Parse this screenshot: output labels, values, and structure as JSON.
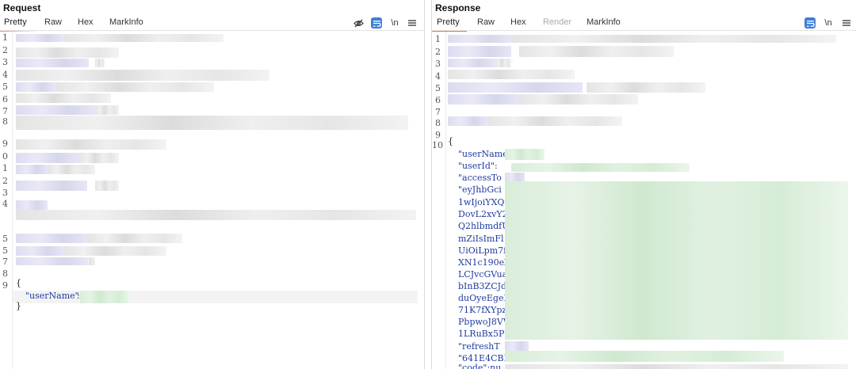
{
  "request": {
    "title": "Request",
    "tabs": [
      "Pretty",
      "Raw",
      "Hex",
      "MarkInfo"
    ],
    "active_tab": "Pretty",
    "toolbar": [
      "eye-slash-icon",
      "wrap-icon",
      "newline-toggle",
      "menu-icon"
    ],
    "newline_label": "\\n",
    "line_numbers": [
      "1",
      "2",
      "3",
      "4",
      "5",
      "6",
      "7",
      "8",
      "9",
      "0",
      "1",
      "2",
      "3",
      "4",
      "5",
      "5",
      "7",
      "8",
      "9"
    ],
    "body": {
      "open_brace": "{",
      "key_username": "\"userName\"",
      "colon": ":",
      "close_brace": "}"
    }
  },
  "response": {
    "title": "Response",
    "tabs": [
      "Pretty",
      "Raw",
      "Hex",
      "Render",
      "MarkInfo"
    ],
    "active_tab": "Pretty",
    "disabled_tab": "Render",
    "toolbar": [
      "wrap-icon",
      "newline-toggle",
      "menu-icon"
    ],
    "newline_label": "\\n",
    "line_numbers": [
      "1",
      "2",
      "3",
      "4",
      "5",
      "6",
      "7",
      "8",
      "9",
      "10"
    ],
    "body": {
      "open_brace": "{",
      "lines": [
        "\"userName",
        "\"userId\":",
        "\"accessTo",
        "\"eyJhbGci",
        "1wIjoiYXQ",
        "DovL2xvY2",
        "Q2hlbmdfU",
        "mZiIsImFl",
        "UiOiLpm7f",
        "XN1c190eX",
        "LCJvcGVua",
        "bInB3ZCJd",
        "duOyeEgeN",
        "71K7fXYpz",
        "PbpwoJ8VW",
        "1LRuBx5Pz",
        "\"refreshT",
        "\"641E4CBB",
        "\"code\":nu"
      ]
    }
  }
}
